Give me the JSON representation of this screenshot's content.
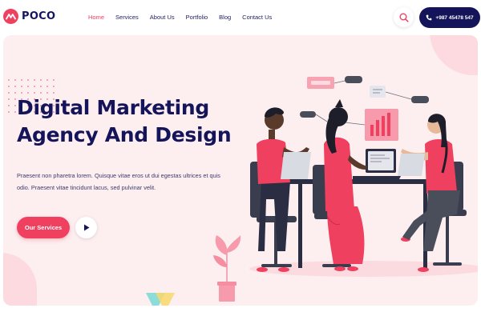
{
  "brand": {
    "name": "POCO",
    "accent": "#ef4060",
    "navy": "#14145a",
    "hero_bg": "#fdeeef"
  },
  "nav": {
    "items": [
      {
        "label": "Home",
        "active": true
      },
      {
        "label": "Services",
        "active": false
      },
      {
        "label": "About Us",
        "active": false
      },
      {
        "label": "Portfolio",
        "active": false
      },
      {
        "label": "Blog",
        "active": false
      },
      {
        "label": "Contact Us",
        "active": false
      }
    ]
  },
  "header": {
    "search_icon": "search-icon",
    "phone": "+987 45478 547",
    "phone_icon": "phone-icon"
  },
  "hero": {
    "title_line1": "Digital Marketing",
    "title_line2": "Agency And Design",
    "description_line1": "Praesent non pharetra lorem. Quisque vitae eros ut dui egestas ultrices et quis",
    "description_line2": "odio. Praesent vitae tincidunt lacus, sed pulvinar velit.",
    "cta_label": "Our Services",
    "play_icon": "play-icon"
  }
}
